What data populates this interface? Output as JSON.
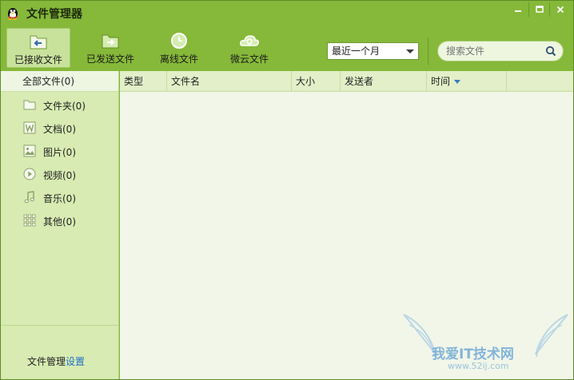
{
  "window": {
    "title": "文件管理器"
  },
  "toolbar": {
    "tabs": [
      {
        "label": "已接收文件",
        "icon": "inbox-download-icon",
        "active": true
      },
      {
        "label": "已发送文件",
        "icon": "outbox-upload-icon",
        "active": false
      },
      {
        "label": "离线文件",
        "icon": "clock-icon",
        "active": false
      },
      {
        "label": "微云文件",
        "icon": "cloud-icon",
        "active": false
      }
    ],
    "range": {
      "selected": "最近一个月"
    },
    "search": {
      "placeholder": "搜索文件"
    }
  },
  "sidebar": {
    "all_label": "全部文件(0)",
    "items": [
      {
        "label": "文件夹(0)",
        "icon": "folder-icon"
      },
      {
        "label": "文档(0)",
        "icon": "document-icon"
      },
      {
        "label": "图片(0)",
        "icon": "image-icon"
      },
      {
        "label": "视频(0)",
        "icon": "video-icon"
      },
      {
        "label": "音乐(0)",
        "icon": "music-note-icon"
      },
      {
        "label": "其他(0)",
        "icon": "grid-icon"
      }
    ],
    "footer": {
      "text": "文件管理",
      "link": "设置"
    }
  },
  "table": {
    "columns": [
      "类型",
      "文件名",
      "大小",
      "发送者",
      "时间"
    ],
    "rows": []
  },
  "watermark": {
    "text": "我爱IT技术网",
    "url": "www.52ij.com"
  },
  "colors": {
    "chrome": "#86b83a",
    "sidebar": "#d7ebb2",
    "content": "#f1f6e8",
    "link": "#1d6fc7"
  }
}
